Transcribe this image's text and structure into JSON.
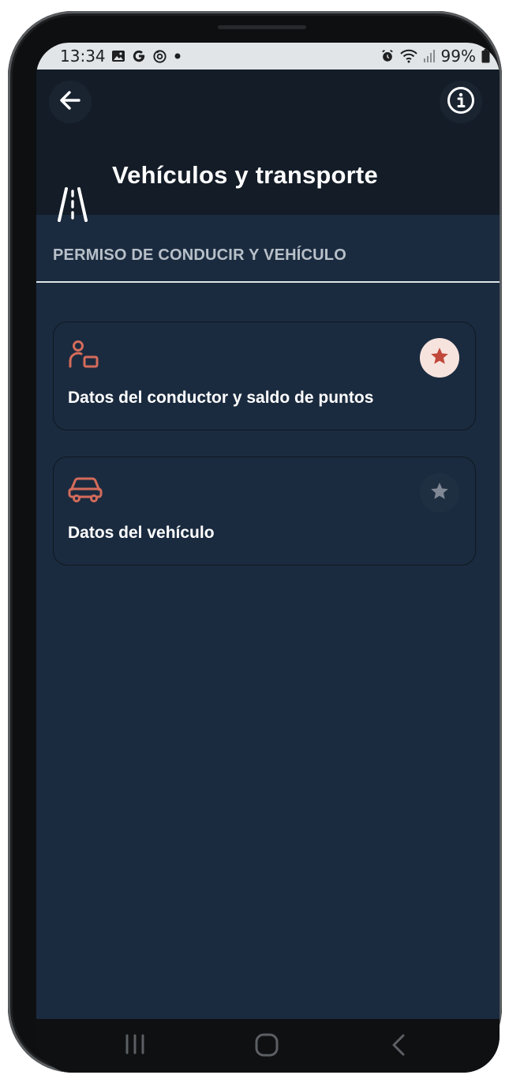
{
  "status_bar": {
    "time": "13:34",
    "left_icons": [
      "gallery-icon",
      "google-icon",
      "sync-icon",
      "dot-icon"
    ],
    "right_icons": [
      "alarm-icon",
      "wifi-icon",
      "signal-icon",
      "battery-icon"
    ],
    "battery": "99%"
  },
  "header": {
    "back_icon": "arrow-left-icon",
    "info_icon": "info-icon",
    "title_icon": "road-icon",
    "title": "Vehículos y transporte"
  },
  "section": {
    "title": "PERMISO DE CONDUCIR Y VEHÍCULO"
  },
  "cards": [
    {
      "icon": "driver-icon",
      "label": "Datos del conductor y saldo de puntos",
      "favorite": true
    },
    {
      "icon": "car-icon",
      "label": "Datos del vehículo",
      "favorite": false
    }
  ],
  "nav_bar": [
    "recent-apps-icon",
    "home-icon",
    "back-icon"
  ],
  "colors": {
    "accent": "#d46b5b",
    "star_active": "#c0473a",
    "star_active_bg": "#f7e3de",
    "star_inactive": "#7f8894",
    "header_bg": "#131c27",
    "content_bg": "#1b2b3f"
  }
}
